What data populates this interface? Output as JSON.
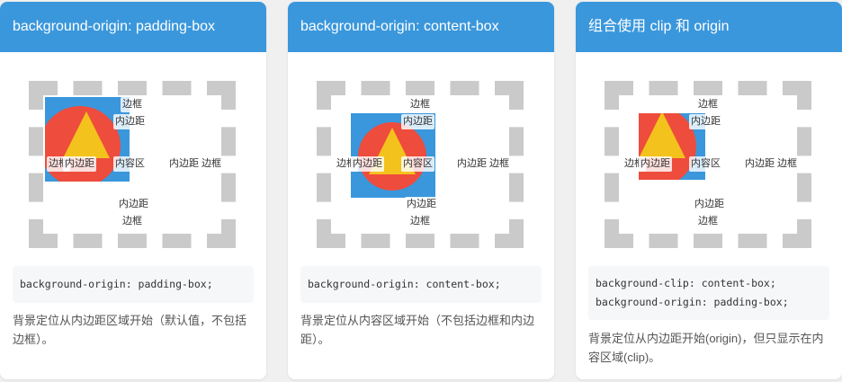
{
  "cards": [
    {
      "title": "background-origin: padding-box",
      "labels": {
        "border_top": "边框",
        "padding_top": "内边距",
        "border_left": "边框",
        "padding_left": "内边距",
        "content": "内容区",
        "padding_right_border": "内边距 边框",
        "padding_bottom": "内边距",
        "border_bottom": "边框"
      },
      "code": "background-origin: padding-box;",
      "description": "背景定位从内边距区域开始（默认值，不包括边框）。"
    },
    {
      "title": "background-origin: content-box",
      "labels": {
        "border_top": "边框",
        "padding_top": "内边距",
        "border_left": "边框",
        "padding_left": "内边距",
        "content": "内容区",
        "padding_right_border": "内边距 边框",
        "padding_bottom": "内边距",
        "border_bottom": "边框"
      },
      "code": "background-origin: content-box;",
      "description": "背景定位从内容区域开始（不包括边框和内边距）。"
    },
    {
      "title": "组合使用 clip 和 origin",
      "labels": {
        "border_top": "边框",
        "padding_top": "内边距",
        "border_left": "边框",
        "padding_left": "内边距",
        "content": "内容区",
        "padding_right_border": "内边距 边框",
        "padding_bottom": "内边距",
        "border_bottom": "边框"
      },
      "code_line1": "background-clip: content-box;",
      "code_line2": "background-origin: padding-box;",
      "description": "背景定位从内边距开始(origin)，但只显示在内容区域(clip)。"
    }
  ],
  "colors": {
    "header": "#3a97dc",
    "border_dash": "#cacaca",
    "image_bg": "#3a97dc",
    "circle": "#ee4c3c",
    "triangle": "#f4c21c"
  }
}
